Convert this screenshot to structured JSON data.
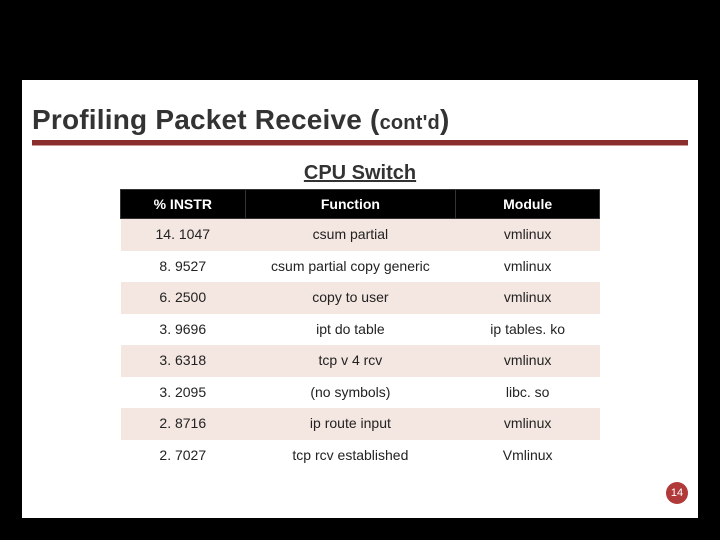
{
  "title_main": "Profiling Packet Receive (",
  "title_contd": "cont'd",
  "title_close": ")",
  "subtitle": "CPU Switch",
  "headers": {
    "instr": "% INSTR",
    "func": "Function",
    "module": "Module"
  },
  "rows": [
    {
      "instr": "14. 1047",
      "func": "csum partial",
      "module": "vmlinux"
    },
    {
      "instr": "8. 9527",
      "func": "csum partial copy generic",
      "module": "vmlinux"
    },
    {
      "instr": "6. 2500",
      "func": "copy to user",
      "module": "vmlinux"
    },
    {
      "instr": "3. 9696",
      "func": "ipt do table",
      "module": "ip tables. ko"
    },
    {
      "instr": "3. 6318",
      "func": "tcp v 4 rcv",
      "module": "vmlinux"
    },
    {
      "instr": "3. 2095",
      "func": "(no symbols)",
      "module": "libc. so"
    },
    {
      "instr": "2. 8716",
      "func": "ip route input",
      "module": "vmlinux"
    },
    {
      "instr": "2. 7027",
      "func": "tcp rcv established",
      "module": "Vmlinux"
    }
  ],
  "page_number": "14",
  "chart_data": {
    "type": "table",
    "title": "CPU Switch",
    "columns": [
      "% INSTR",
      "Function",
      "Module"
    ],
    "data": [
      [
        14.1047,
        "csum partial",
        "vmlinux"
      ],
      [
        8.9527,
        "csum partial copy generic",
        "vmlinux"
      ],
      [
        6.25,
        "copy to user",
        "vmlinux"
      ],
      [
        3.9696,
        "ipt do table",
        "ip tables. ko"
      ],
      [
        3.6318,
        "tcp v 4 rcv",
        "vmlinux"
      ],
      [
        3.2095,
        "(no symbols)",
        "libc. so"
      ],
      [
        2.8716,
        "ip route input",
        "vmlinux"
      ],
      [
        2.7027,
        "tcp rcv established",
        "Vmlinux"
      ]
    ]
  }
}
